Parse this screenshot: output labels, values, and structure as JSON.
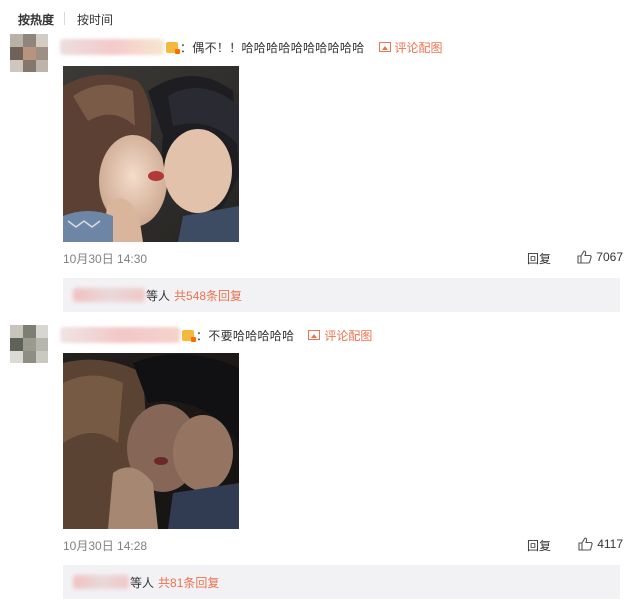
{
  "sort_bar": {
    "hot_label": "按热度",
    "time_label": "按时间"
  },
  "comments": [
    {
      "text": "：偶不！！哈哈哈哈哈哈哈哈哈哈",
      "pic_link": "评论配图",
      "time": "10月30日 14:30",
      "reply_label": "回复",
      "likes": "7067",
      "replies": {
        "who": "等人",
        "total": "共548条回复"
      }
    },
    {
      "text": "：不要哈哈哈哈哈",
      "pic_link": "评论配图",
      "time": "10月30日 14:28",
      "reply_label": "回复",
      "likes": "4117",
      "replies": {
        "who": "等人",
        "total": "共81条回复"
      }
    }
  ],
  "colors": {
    "link": "#eb7350",
    "reply_bg": "#f2f2f5",
    "muted": "#808080"
  },
  "icons": [
    "picture-icon",
    "thumbs-up-icon",
    "vip-badge-icon"
  ]
}
